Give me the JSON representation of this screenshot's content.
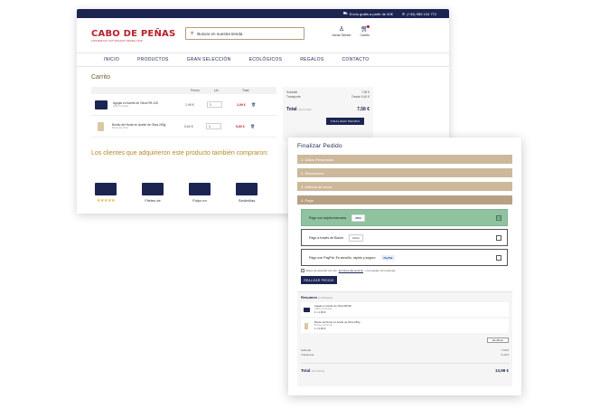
{
  "topbar": {
    "shipping": "Envío gratis a partir de 40€",
    "phone": "(+34) 985 104 772"
  },
  "header": {
    "logo": "CABO DE PEÑAS",
    "logo_sub": "CONSERVAS ASTURIANAS DESDE 1928",
    "search_placeholder": "Buscar en nuestra tienda",
    "login_label": "Iniciar Sesión",
    "cart_label": "Carrito"
  },
  "nav": [
    "INICIO",
    "PRODUCTOS",
    "GRAN SELECCIÓN",
    "ECOLÓGICOS",
    "REGALOS",
    "CONTACTO"
  ],
  "cart": {
    "title": "Carrito",
    "columns": [
      "Precio",
      "Ud.",
      "Total"
    ],
    "rows": [
      {
        "name": "Agujas en Aceite de Oliva RR-125",
        "sub": "Cabo de Peñas",
        "price": "1,99 €",
        "qty": "1",
        "total": "1,99 €"
      },
      {
        "name": "Bonito del Norte en Aceite de Oliva 250g",
        "sub": "Bonito del Norte",
        "price": "5,60 €",
        "qty": "1",
        "total": "5,60 €"
      }
    ],
    "summary": {
      "subtotal_label": "Subtotal",
      "subtotal": "7,59 €",
      "shipping_label": "Transporte",
      "shipping": "Desde 5,40 €",
      "total_label": "Total",
      "total_note": "(IVA incluido)",
      "total": "7,58 €",
      "finalize_label": "FINALIZAR PEDIDO"
    }
  },
  "also_bought": {
    "title": "Los clientes que adquirieron este producto también compraron:",
    "items": [
      {
        "label": "★★★★★"
      },
      {
        "label": "Filetes de"
      },
      {
        "label": "Pulpo en"
      },
      {
        "label": "Sardinillas"
      }
    ]
  },
  "checkout": {
    "title": "Finalizar Pedido",
    "steps": [
      "1. Datos Personales",
      "2. Direcciones",
      "3. Método de envío",
      "4. Pago"
    ],
    "payment_options": [
      {
        "label": "Pago con tarjeta bancaria",
        "badge": "VISA",
        "selected": true
      },
      {
        "label": "Pago a través de Bizum",
        "badge": "bizum",
        "selected": false
      },
      {
        "label": "Pago con PayPal. Es sencillo, rápido y seguro",
        "badge": "PayPal",
        "selected": false
      }
    ],
    "terms_prefix": "Estoy de acuerdo con los",
    "terms_link": "términos del servicio",
    "terms_suffix": "y los acepto sin reservas.",
    "pay_button": "REALIZAR PEDIDO",
    "summary": {
      "title": "Resumen",
      "count": "(2 artículos)",
      "items": [
        {
          "name": "Agujas en Aceite de Oliva RR-90",
          "sub": "Cabo de Peñas",
          "qty": "1 x 1,99 €"
        },
        {
          "name": "Bonito del Norte en Aceite de Oliva 250g",
          "sub": "Bonito del Norte",
          "qty": "1 x 5,60 €"
        }
      ],
      "modify_label": "Modificar",
      "subtotal_label": "Subtotal",
      "subtotal": "7,59 €",
      "shipping_label": "Transporte",
      "shipping": "6,40 €",
      "total_label": "Total",
      "total_note": "(IVA incluido)",
      "total": "13,98 €"
    }
  }
}
